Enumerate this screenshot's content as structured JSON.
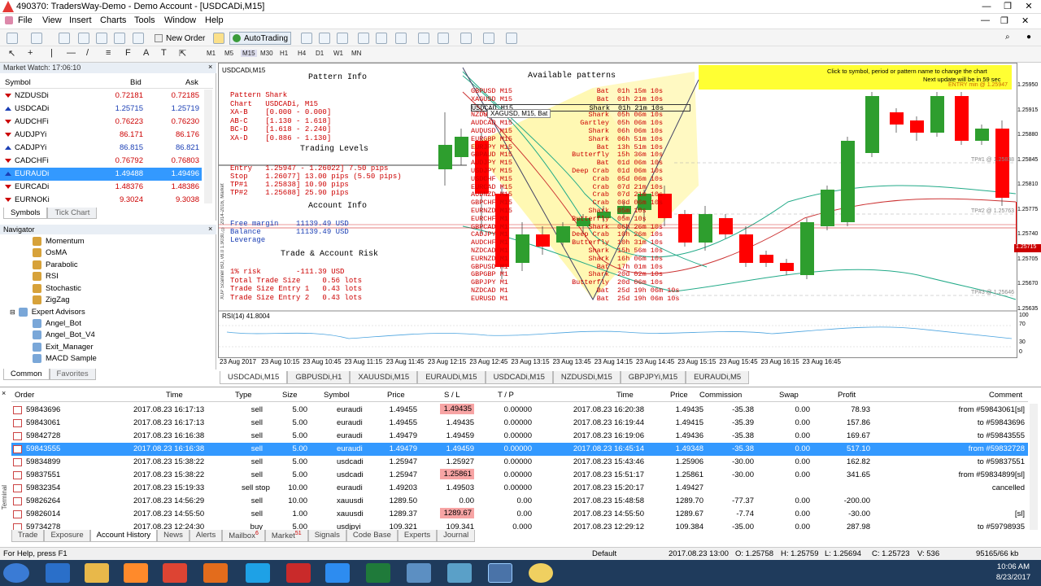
{
  "window": {
    "title": "490370: TradersWay-Demo - Demo Account - [USDCADi,M15]",
    "min": "—",
    "restore": "❐",
    "close": "✕"
  },
  "menu": [
    "File",
    "View",
    "Insert",
    "Charts",
    "Tools",
    "Window",
    "Help"
  ],
  "toolbar": {
    "new_order": "New Order",
    "auto_trading": "AutoTrading"
  },
  "timeframes": [
    "M1",
    "M5",
    "M15",
    "M30",
    "H1",
    "H4",
    "D1",
    "W1",
    "MN"
  ],
  "market_watch": {
    "title": "Market Watch: 17:06:10",
    "col_symbol": "Symbol",
    "col_bid": "Bid",
    "col_ask": "Ask",
    "rows": [
      {
        "s": "NZDUSDi",
        "b": "0.72181",
        "a": "0.72185",
        "dir": "down"
      },
      {
        "s": "USDCADi",
        "b": "1.25715",
        "a": "1.25719",
        "dir": "up"
      },
      {
        "s": "AUDCHFi",
        "b": "0.76223",
        "a": "0.76230",
        "dir": "down"
      },
      {
        "s": "AUDJPYi",
        "b": "86.171",
        "a": "86.176",
        "dir": "down"
      },
      {
        "s": "CADJPYi",
        "b": "86.815",
        "a": "86.821",
        "dir": "up"
      },
      {
        "s": "CADCHFi",
        "b": "0.76792",
        "a": "0.76803",
        "dir": "down"
      },
      {
        "s": "EURAUDi",
        "b": "1.49488",
        "a": "1.49496",
        "dir": "up"
      },
      {
        "s": "EURCADi",
        "b": "1.48376",
        "a": "1.48386",
        "dir": "down"
      },
      {
        "s": "EURNOKi",
        "b": "9.3024",
        "a": "9.3038",
        "dir": "down"
      }
    ],
    "tabs": [
      "Symbols",
      "Tick Chart"
    ]
  },
  "navigator": {
    "title": "Navigator",
    "items": [
      "Momentum",
      "OsMA",
      "Parabolic",
      "RSI",
      "Stochastic",
      "ZigZag"
    ],
    "expert_advisors": "Expert Advisors",
    "experts": [
      "Angel_Bot",
      "Angel_Bot_V4",
      "Exit_Manager",
      "MACD Sample"
    ],
    "tabs": [
      "Common",
      "Favorites"
    ]
  },
  "chart": {
    "symbol": "USDCADi,M15",
    "pattern_info_title": "Pattern Info",
    "pattern_lines": [
      "Pattern Shark",
      "Chart   USDCADi, M15",
      "XA-B    [0.000 - 0.000]",
      "AB-C    [1.130 - 1.618]",
      "BC-D    [1.618 - 2.240]",
      "XA-D    [0.886 - 1.130]"
    ],
    "trading_levels_title": "Trading Levels",
    "trading_lines": [
      "Entry   1.25947 - 1.26022] 7.50 pips",
      "Stop    1.26077] 13.00 pips (5.50 pips)",
      "TP#1    1.25838] 10.90 pips",
      "TP#2    1.25688] 25.90 pips"
    ],
    "account_info_title": "Account Info",
    "account_lines": [
      "Free margin    11139.49 USD",
      "Balance        11139.49 USD",
      "Leverage"
    ],
    "risk_title": "Trade & Account Risk",
    "risk_lines": [
      "1% risk        -111.39 USD",
      "Total Trade Size     0.56 lots",
      "Trade Size Entry 1   0.43 lots",
      "Trade Size Entry 2   0.43 lots"
    ],
    "available_title": "Available patterns",
    "patterns": [
      {
        "sym": "GBPUSD M15",
        "p": "Bat",
        "t": "01h 15m 10s"
      },
      {
        "sym": "XAGUSD M15",
        "p": "Bat",
        "t": "01h 21m 10s"
      },
      {
        "sym": "USDCAD M15",
        "p": "Shark",
        "t": "01h 21m 10s"
      },
      {
        "sym": "NZDUSD M15",
        "p": "Shark",
        "t": "05h 06m 10s"
      },
      {
        "sym": "AUDCAD M15",
        "p": "Gartley",
        "t": "05h 06m 10s"
      },
      {
        "sym": "AUDUSD M15",
        "p": "Shark",
        "t": "06h 06m 10s"
      },
      {
        "sym": "EURGBP M15",
        "p": "Shark",
        "t": "06h 51m 10s"
      },
      {
        "sym": "EURJPY M15",
        "p": "Bat",
        "t": "13h 51m 10s"
      },
      {
        "sym": "GBPAUD M15",
        "p": "Butterfly",
        "t": "15h 36m 10s"
      },
      {
        "sym": "AUDJPY M15",
        "p": "Bat",
        "t": "01d 06m 10s"
      },
      {
        "sym": "USDJPY M15",
        "p": "Deep Crab",
        "t": "01d 06m 10s"
      },
      {
        "sym": "USDCHF M15",
        "p": "Crab",
        "t": "05d 06m 10s"
      },
      {
        "sym": "EURCAD M15",
        "p": "Crab",
        "t": "07d 21m 10s"
      },
      {
        "sym": "AUDNZD M15",
        "p": "Crab",
        "t": "07d 21m 10s"
      },
      {
        "sym": "GBPCHF M15",
        "p": "Crab",
        "t": "08d 06m 10s"
      },
      {
        "sym": "EURNZD M15",
        "p": "Shark",
        "t": "05m 10s"
      },
      {
        "sym": "EURCHF M1",
        "p": "Butterfly",
        "t": "05m 10s"
      },
      {
        "sym": "GBPCAD M1",
        "p": "Shark",
        "t": "06h 26m 10s"
      },
      {
        "sym": "CADJPY M1",
        "p": "Deep Crab",
        "t": "10h 26m 10s"
      },
      {
        "sym": "AUDCHF M1",
        "p": "Butterfly",
        "t": "10h 31m 10s"
      },
      {
        "sym": "NZDCAD M1",
        "p": "Shark",
        "t": "15h 56m 10s"
      },
      {
        "sym": "EURNZD M1",
        "p": "Shark",
        "t": "16h 06m 10s"
      },
      {
        "sym": "GBPUSD M1",
        "p": "Bat",
        "t": "17h 01m 10s"
      },
      {
        "sym": "GBPGBP M1",
        "p": "Shark",
        "t": "20d 02m 10s"
      },
      {
        "sym": "GBPJPY M1",
        "p": "Butterfly",
        "t": "20d 06m 10s"
      },
      {
        "sym": "NZDCAD M1",
        "p": "Bat",
        "t": "25d 19h 06m 10s"
      },
      {
        "sym": "EURUSD M1",
        "p": "Bat",
        "t": "25d 19h 06m 10s"
      }
    ],
    "tooltip": "XAGUSD, M15, Bat",
    "hint": "Click to symbol, period or pattern name to change the chart",
    "next_update": "Next update will be in 59 sec",
    "entry_label": "ENTRY min @ 1.25947",
    "tp1": "TP#1 @ 1.25838",
    "tp2": "TP#2 @ 1.25763",
    "tp3": "TP#3 @ 1.25646",
    "side_label": "XUP Scanner BO, v8.0 1.9030, © 2014-2016, Market",
    "rsi_label": "RSI(14) 41.8004",
    "rsi_levels": [
      "100",
      "70",
      "30",
      "0"
    ],
    "prices": [
      "1.25950",
      "1.25915",
      "1.25880",
      "1.25845",
      "1.25810",
      "1.25775",
      "1.25740",
      "1.25705",
      "1.25670",
      "1.25635"
    ],
    "price_tag": "1.25715",
    "times": [
      "23 Aug 2017",
      "23 Aug 10:15",
      "23 Aug 10:45",
      "23 Aug 11:15",
      "23 Aug 11:45",
      "23 Aug 12:15",
      "23 Aug 12:45",
      "23 Aug 13:15",
      "23 Aug 13:45",
      "23 Aug 14:15",
      "23 Aug 14:45",
      "23 Aug 15:15",
      "23 Aug 15:45",
      "23 Aug 16:15",
      "23 Aug 16:45"
    ],
    "tabs": [
      "USDCADi,M15",
      "GBPUSDi,H1",
      "XAUUSDi,M15",
      "EURAUDi,M15",
      "USDCADi,M15",
      "NZDUSDi,M15",
      "GBPJPYi,M15",
      "EURAUDi,M5"
    ]
  },
  "terminal": {
    "cols": [
      "Order",
      "Time",
      "Type",
      "Size",
      "Symbol",
      "Price",
      "S / L",
      "T / P",
      "Time",
      "Price",
      "Commission",
      "Swap",
      "Profit",
      "Comment"
    ],
    "rows": [
      {
        "order": "59843696",
        "time": "2017.08.23 16:17:13",
        "type": "sell",
        "size": "5.00",
        "sym": "euraudi",
        "price": "1.49455",
        "sl": "1.49435",
        "slhl": true,
        "tp": "0.00000",
        "ctime": "2017.08.23 16:20:38",
        "cprice": "1.49435",
        "comm": "-35.38",
        "swap": "0.00",
        "profit": "78.93",
        "comment": "from #59843061[sl]"
      },
      {
        "order": "59843061",
        "time": "2017.08.23 16:17:13",
        "type": "sell",
        "size": "5.00",
        "sym": "euraudi",
        "price": "1.49455",
        "sl": "1.49435",
        "slhl": false,
        "tp": "0.00000",
        "ctime": "2017.08.23 16:19:44",
        "cprice": "1.49415",
        "comm": "-35.39",
        "swap": "0.00",
        "profit": "157.86",
        "comment": "to #59843696"
      },
      {
        "order": "59842728",
        "time": "2017.08.23 16:16:38",
        "type": "sell",
        "size": "5.00",
        "sym": "euraudi",
        "price": "1.49479",
        "sl": "1.49459",
        "slhl": false,
        "tp": "0.00000",
        "ctime": "2017.08.23 16:19:06",
        "cprice": "1.49436",
        "comm": "-35.38",
        "swap": "0.00",
        "profit": "169.67",
        "comment": "to #59843555"
      },
      {
        "order": "59843555",
        "time": "2017.08.23 16:16:38",
        "type": "sell",
        "size": "5.00",
        "sym": "euraudi",
        "price": "1.49479",
        "sl": "1.49459",
        "slhl": false,
        "tp": "0.00000",
        "ctime": "2017.08.23 16:45:14",
        "cprice": "1.49348",
        "comm": "-35.38",
        "swap": "0.00",
        "profit": "517.10",
        "comment": "from #59832728",
        "sel": true
      },
      {
        "order": "59834899",
        "time": "2017.08.23 15:38:22",
        "type": "sell",
        "size": "5.00",
        "sym": "usdcadi",
        "price": "1.25947",
        "sl": "1.25927",
        "slhl": false,
        "tp": "0.00000",
        "ctime": "2017.08.23 15:43:46",
        "cprice": "1.25906",
        "comm": "-30.00",
        "swap": "0.00",
        "profit": "162.82",
        "comment": "to #59837551"
      },
      {
        "order": "59837551",
        "time": "2017.08.23 15:38:22",
        "type": "sell",
        "size": "5.00",
        "sym": "usdcadi",
        "price": "1.25947",
        "sl": "1.25861",
        "slhl": true,
        "tp": "0.00000",
        "ctime": "2017.08.23 15:51:17",
        "cprice": "1.25861",
        "comm": "-30.00",
        "swap": "0.00",
        "profit": "341.65",
        "comment": "from #59834899[sl]"
      },
      {
        "order": "59832354",
        "time": "2017.08.23 15:19:33",
        "type": "sell stop",
        "size": "10.00",
        "sym": "euraudi",
        "price": "1.49203",
        "sl": "1.49503",
        "slhl": false,
        "tp": "0.00000",
        "ctime": "2017.08.23 15:20:17",
        "cprice": "1.49427",
        "comm": "",
        "swap": "",
        "profit": "",
        "comment": "cancelled"
      },
      {
        "order": "59826264",
        "time": "2017.08.23 14:56:29",
        "type": "sell",
        "size": "10.00",
        "sym": "xauusdi",
        "price": "1289.50",
        "sl": "0.00",
        "slhl": false,
        "tp": "0.00",
        "ctime": "2017.08.23 15:48:58",
        "cprice": "1289.70",
        "comm": "-77.37",
        "swap": "0.00",
        "profit": "-200.00",
        "comment": ""
      },
      {
        "order": "59826014",
        "time": "2017.08.23 14:55:50",
        "type": "sell",
        "size": "1.00",
        "sym": "xauusdi",
        "price": "1289.37",
        "sl": "1289.67",
        "slhl": true,
        "tp": "0.00",
        "ctime": "2017.08.23 14:55:50",
        "cprice": "1289.67",
        "comm": "-7.74",
        "swap": "0.00",
        "profit": "-30.00",
        "comment": "[sl]"
      },
      {
        "order": "59734278",
        "time": "2017.08.23 12:24:30",
        "type": "buy",
        "size": "5.00",
        "sym": "usdjpyi",
        "price": "109.321",
        "sl": "109.341",
        "slhl": false,
        "tp": "0.000",
        "ctime": "2017.08.23 12:29:12",
        "cprice": "109.384",
        "comm": "-35.00",
        "swap": "0.00",
        "profit": "287.98",
        "comment": "to #59798935"
      }
    ],
    "tabs": [
      "Trade",
      "Exposure",
      "Account History",
      "News",
      "Alerts",
      "Mailbox",
      "Market",
      "Signals",
      "Code Base",
      "Experts",
      "Journal"
    ],
    "mailbox_badge": "6",
    "market_badge": "51",
    "side_label": "Terminal"
  },
  "status": {
    "help": "For Help, press F1",
    "profile": "Default",
    "datetime": "2017.08.23 13:00",
    "open": "O: 1.25758",
    "high": "H: 1.25759",
    "low": "L: 1.25694",
    "close": "C: 1.25723",
    "volume": "V: 536",
    "traffic": "95165/66 kb"
  },
  "taskbar": {
    "time": "10:06 AM",
    "date": "8/23/2017"
  },
  "colors": {
    "bull": "#2e9e2e",
    "bear": "#ff0000",
    "selection": "#3399ff"
  }
}
